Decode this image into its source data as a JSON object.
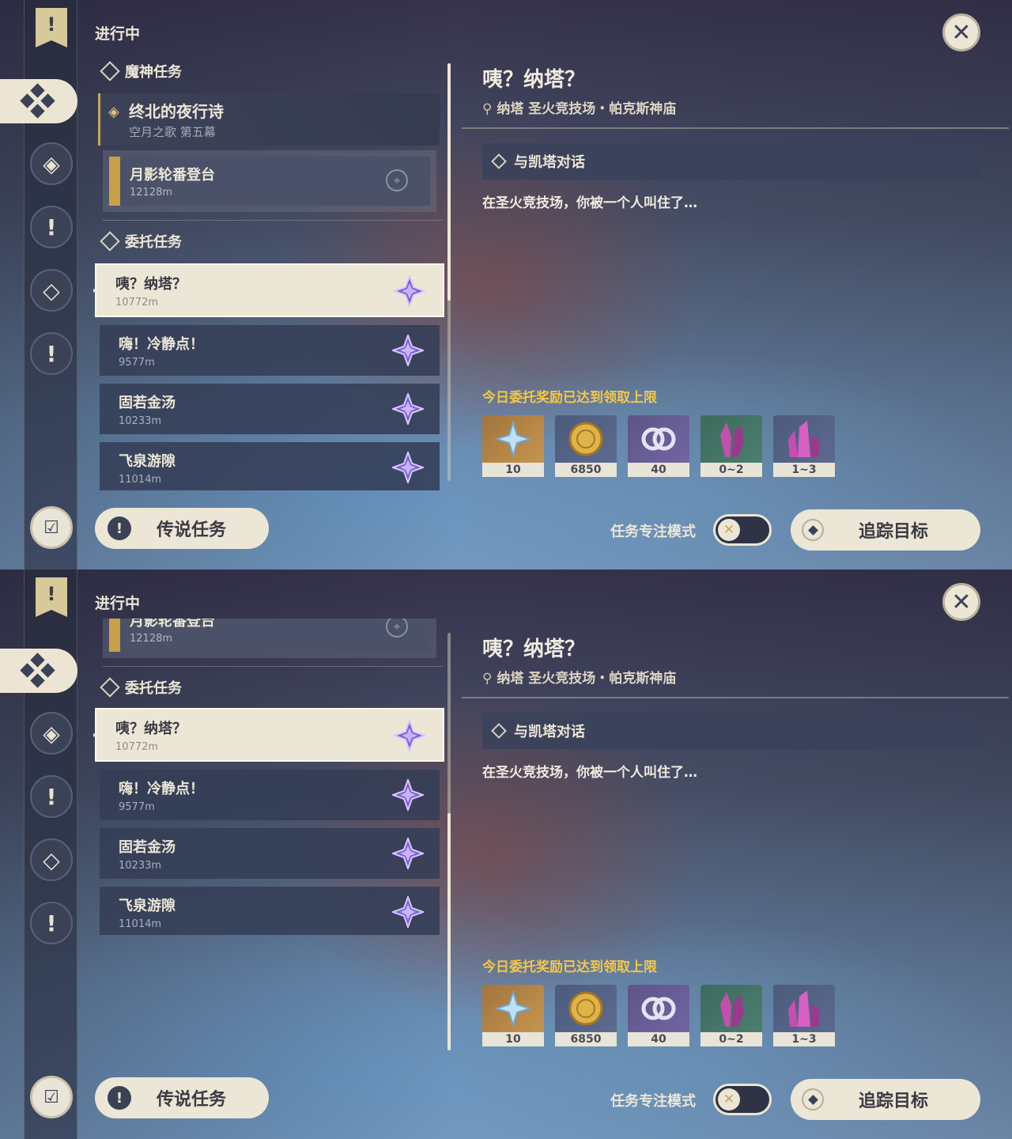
{
  "header": {
    "status_label": "进行中",
    "close_icon": "close-icon"
  },
  "list": {
    "archon_section": "魔神任务",
    "archon_quest": {
      "title": "终北的夜行诗",
      "subtitle": "空月之歌 第五幕"
    },
    "archon_subquest": {
      "title": "月影轮番登台",
      "distance": "12128m"
    },
    "commission_section": "委托任务",
    "commissions": [
      {
        "title": "咦？纳塔？",
        "distance": "10772m",
        "selected": true
      },
      {
        "title": "嗨！冷静点！",
        "distance": "9577m",
        "selected": false
      },
      {
        "title": "固若金汤",
        "distance": "10233m",
        "selected": false
      },
      {
        "title": "飞泉游隙",
        "distance": "11014m",
        "selected": false
      }
    ]
  },
  "detail": {
    "title": "咦？纳塔？",
    "location": "纳塔 圣火竞技场・帕克斯神庙",
    "objective": "与凯塔对话",
    "description": "在圣火竞技场，你被一个人叫住了…",
    "reward_notice": "今日委托奖励已达到领取上限",
    "rewards": [
      {
        "icon": "primogem-icon",
        "qty": "10"
      },
      {
        "icon": "mora-icon",
        "qty": "6850"
      },
      {
        "icon": "companionship-exp-icon",
        "qty": "40"
      },
      {
        "icon": "green-crystal-icon",
        "qty": "0~2"
      },
      {
        "icon": "purple-crystal-icon",
        "qty": "1~3"
      }
    ]
  },
  "footer": {
    "legend_button": "传说任务",
    "focus_mode_label": "任务专注模式",
    "track_button": "追踪目标"
  },
  "colors": {
    "accent_gold": "#f3c748",
    "panel_light": "#ece6d6",
    "star_purple": "#7c5ccf"
  }
}
